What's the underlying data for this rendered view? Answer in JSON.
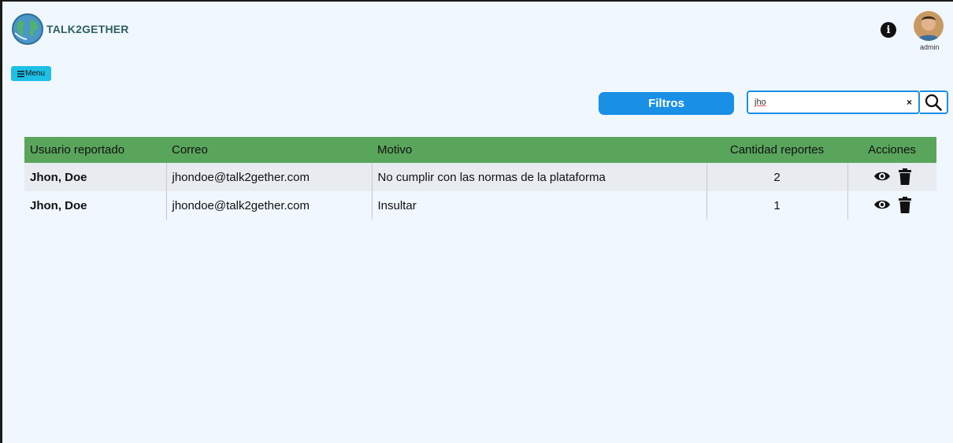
{
  "header": {
    "brand": "TALK2GETHER",
    "user_label": "admin"
  },
  "menu": {
    "label": "Menu"
  },
  "filters": {
    "button_label": "Filtros",
    "search_value": "jho",
    "clear_symbol": "×"
  },
  "table": {
    "columns": [
      "Usuario reportado",
      "Correo",
      "Motivo",
      "Cantidad reportes",
      "Acciones"
    ],
    "rows": [
      {
        "user": "Jhon, Doe",
        "email": "jhondoe@talk2gether.com",
        "reason": "No cumplir con las normas de la plataforma",
        "count": "2"
      },
      {
        "user": "Jhon, Doe",
        "email": "jhondoe@talk2gether.com",
        "reason": "Insultar",
        "count": "1"
      }
    ]
  },
  "colors": {
    "background": "#f0f7ff",
    "table_header": "#5aa55c",
    "primary": "#1a8fe6",
    "menu_button": "#1ec0e6"
  },
  "icons": [
    "globe-logo-icon",
    "info-icon",
    "avatar",
    "menu-icon",
    "close-icon",
    "search-icon",
    "eye-icon",
    "trash-icon"
  ]
}
